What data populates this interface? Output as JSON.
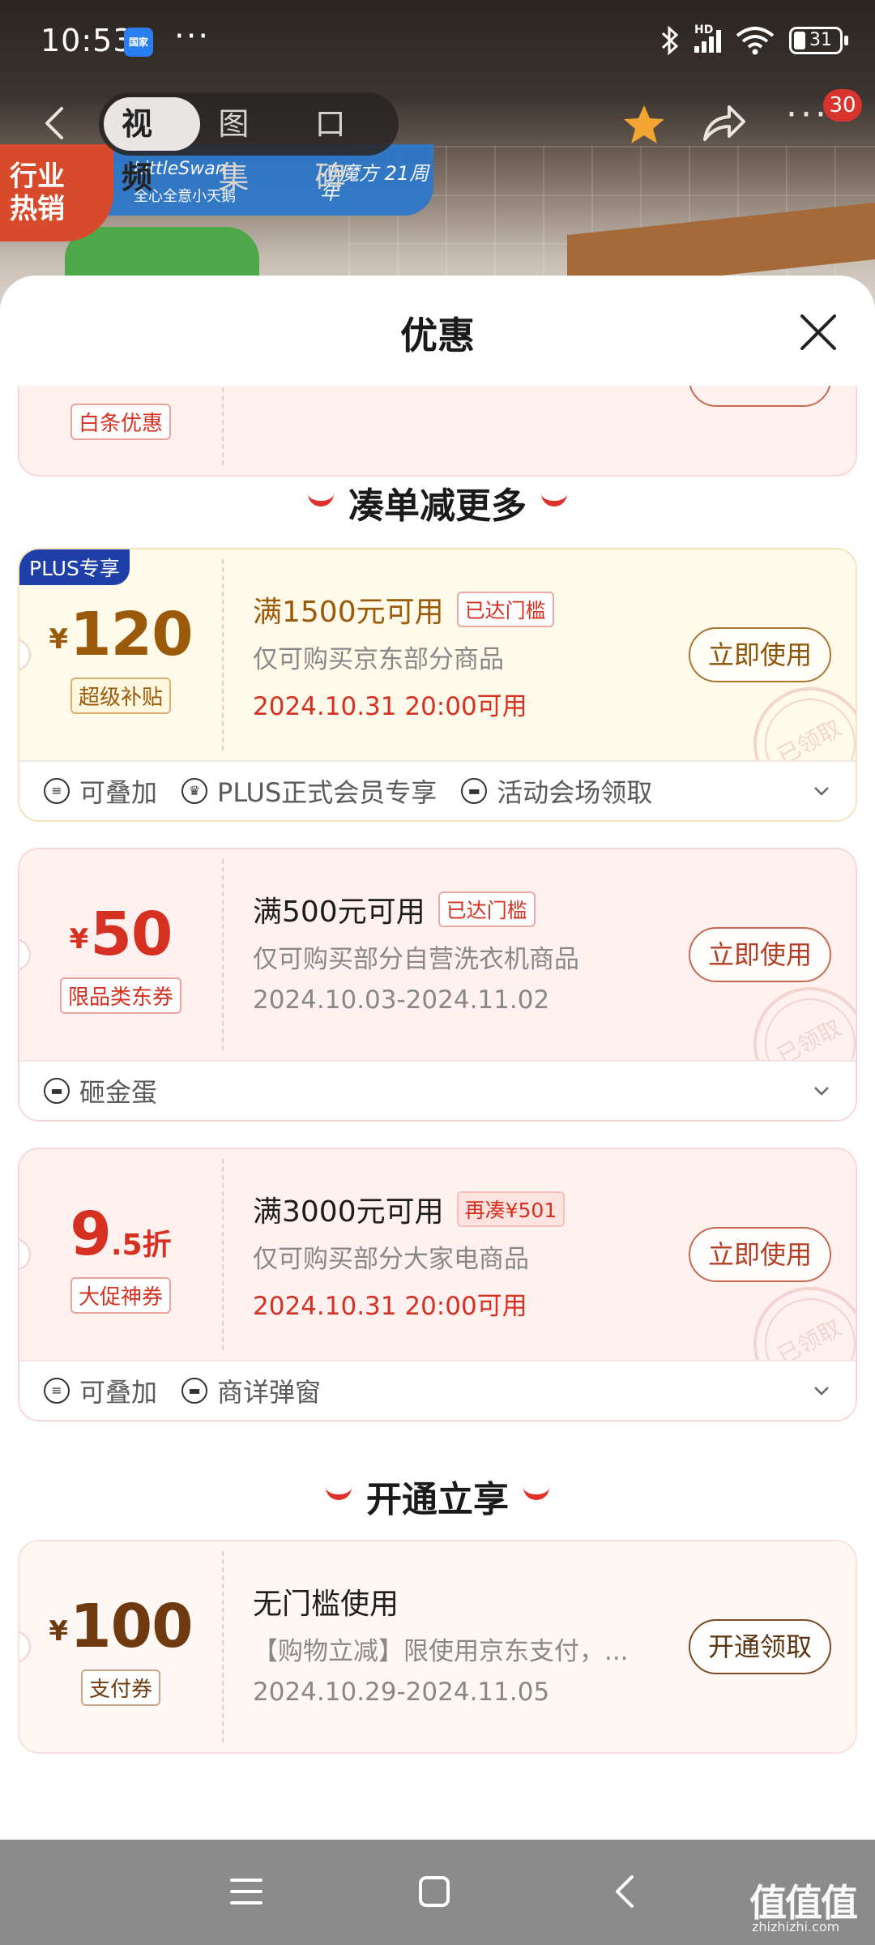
{
  "status_bar": {
    "time": "10:53",
    "app_badge": "国家",
    "more": "···",
    "network": "HD",
    "battery": "31"
  },
  "nav": {
    "tabs": [
      "视频",
      "图集",
      "口碑"
    ],
    "active_tab": 0,
    "badge_count": "30",
    "more": "···"
  },
  "banner": {
    "tag": "行业热销",
    "brand1": "LittleSwan",
    "brand1_sub": "全心全意小天鹅",
    "brand2": "小魔方 21周年"
  },
  "sheet": {
    "title": "优惠"
  },
  "partial_card": {
    "tag": "白条优惠"
  },
  "sections": [
    {
      "title": "凑单减更多"
    },
    {
      "title": "开通立享"
    }
  ],
  "coupons": [
    {
      "badge": "PLUS专享",
      "currency": "¥",
      "amount": "120",
      "type_tag": "超级补贴",
      "condition": "满1500元可用",
      "status_tag": "已达门槛",
      "desc": "仅可购买京东部分商品",
      "date": "2024.10.31 20:00可用",
      "button": "立即使用",
      "stamp": "已领取",
      "footer": [
        "可叠加",
        "PLUS正式会员专享",
        "活动会场领取"
      ]
    },
    {
      "currency": "¥",
      "amount": "50",
      "type_tag": "限品类东券",
      "condition": "满500元可用",
      "status_tag": "已达门槛",
      "desc": "仅可购买部分自营洗衣机商品",
      "date": "2024.10.03-2024.11.02",
      "button": "立即使用",
      "stamp": "已领取",
      "footer": [
        "砸金蛋"
      ]
    },
    {
      "amount_main": "9",
      "amount_suffix": ".5折",
      "type_tag": "大促神券",
      "condition": "满3000元可用",
      "status_tag": "再凑¥501",
      "desc": "仅可购买部分大家电商品",
      "date": "2024.10.31 20:00可用",
      "button": "立即使用",
      "stamp": "已领取",
      "footer": [
        "可叠加",
        "商详弹窗"
      ]
    },
    {
      "currency": "¥",
      "amount": "100",
      "type_tag": "支付券",
      "condition": "无门槛使用",
      "desc": "【购物立减】限使用京东支付，...",
      "date": "2024.10.29-2024.11.05",
      "button": "开通领取"
    }
  ],
  "watermark": {
    "main": "值值值",
    "sub": "zhizhizhi.com"
  },
  "colors": {
    "accent": "#d63020",
    "plus_badge": "#1f3fa8",
    "gold": "#9a5a0a"
  }
}
